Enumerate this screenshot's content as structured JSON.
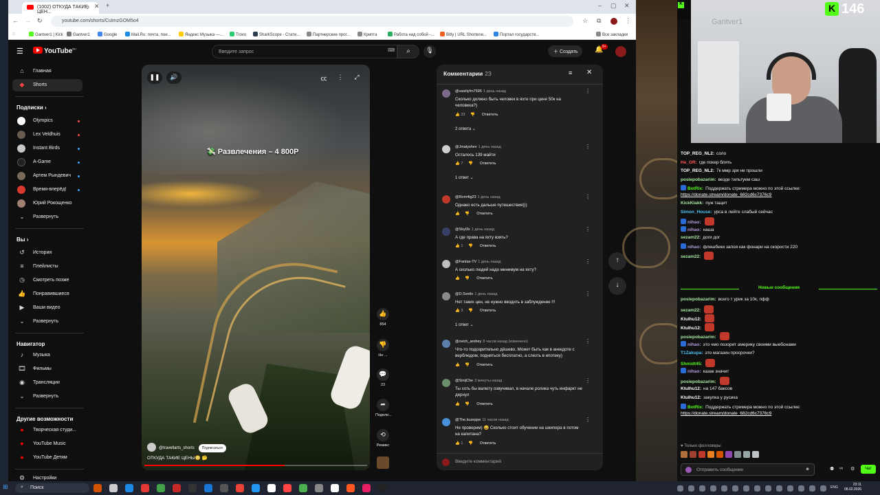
{
  "browser": {
    "tab_title": "(1002) ОТКУДА ТАКИЕ ЦЕН...",
    "url": "youtube.com/shorts/CuImzGOM5o4",
    "bookmarks": [
      "Gantver1 | Kick",
      "Gantver1",
      "Google",
      "Mail.Ru: почта, пои...",
      "Яндекс Музыка —...",
      "Trovo",
      "SharkScope - Стати...",
      "Партнерские прог...",
      "Крипта",
      "Работа над собой -...",
      "Bitly | URL Shortene...",
      "Портал государств..."
    ],
    "all_bookmarks": "Все закладки"
  },
  "header": {
    "logo_text": "YouTube",
    "logo_sup": "RU",
    "search_placeholder": "Введите запрос",
    "create_label": "Создать",
    "bell_badge": "9+"
  },
  "sidebar": {
    "main": [
      {
        "label": "Главная",
        "icon": "home-icon"
      },
      {
        "label": "Shorts",
        "icon": "shorts-icon"
      }
    ],
    "subs_header": "Подписки",
    "subscriptions": [
      {
        "label": "Olympics",
        "color": "#ffffff",
        "live": true
      },
      {
        "label": "Lex Veldhuis",
        "color": "#6a5b4f",
        "live": true
      },
      {
        "label": "Instant Birds",
        "color": "#c8c8c8",
        "live": false
      },
      {
        "label": "A-Game",
        "color": "#202020",
        "live": false
      },
      {
        "label": "Артем Рындевич",
        "color": "#7a6a5a",
        "live": false
      },
      {
        "label": "Время-вперёд!",
        "color": "#d9392c",
        "live": false
      },
      {
        "label": "Юрий Рокощенко",
        "color": "#a08070",
        "live": false
      }
    ],
    "expand1": "Развернуть",
    "you_header": "Вы",
    "you_items": [
      "История",
      "Плейлисты",
      "Смотреть позже",
      "Понравившиеся",
      "Ваши видео",
      "Развернуть"
    ],
    "nav_header": "Навигатор",
    "nav_items": [
      "Музыка",
      "Фильмы",
      "Трансляции",
      "Развернуть"
    ],
    "other_header": "Другие возможности",
    "other_items": [
      "Творческая студи...",
      "YouTube Music",
      "YouTube Детям"
    ],
    "settings": "Настройки"
  },
  "video": {
    "overlay_title": "Развлечения – 4 800Р",
    "channel": "@travellarts_shorts",
    "subscribe": "Подписаться",
    "caption": "ОТКУДА ТАКИЕ ЦЕНЫ😳 🤔",
    "progress": 0.63
  },
  "actions": {
    "likes": "854",
    "dislike": "Не ...",
    "comments": "23",
    "share": "Подели...",
    "remix": "Ремикс"
  },
  "comments": {
    "title": "Комментарии",
    "count": "23",
    "input_placeholder": "Введите комментарий",
    "items": [
      {
        "user": "@vasiliyfm7595",
        "time": "1 день назад",
        "text": "Сколько должно быть человек в яхте при цене 50к на человека?)",
        "likes": "33",
        "reply": "Ответить",
        "replies": "2 ответа",
        "color": "#7b6a8a"
      },
      {
        "user": "@Jmalyshev",
        "time": "1 день назад",
        "text": "Осталось 139 майти",
        "likes": "7",
        "reply": "Ответить",
        "replies": "1 ответ",
        "color": "#cfcfcf"
      },
      {
        "user": "@Rom4ig23",
        "time": "1 день назад",
        "text": "Однако есть дальше путешествия)))",
        "likes": "",
        "reply": "Ответить",
        "replies": "",
        "color": "#c0392b"
      },
      {
        "user": "@Skyl3x",
        "time": "1 день назад",
        "text": "А где права на яхту взять?",
        "likes": "1",
        "reply": "Ответить",
        "replies": "",
        "color": "#3a3f66"
      },
      {
        "user": "@Fantas-TV",
        "time": "1 день назад",
        "text": "А сколько людей надо минимум на яхту?",
        "likes": "",
        "reply": "Ответить",
        "replies": "",
        "color": "#bfbfbf"
      },
      {
        "user": "@D.Svetlo",
        "time": "1 день назад",
        "text": "Нет таких цен, не нужно вводить в заблуждение !!!",
        "likes": "3",
        "reply": "Ответить",
        "replies": "1 ответ",
        "color": "#8a8a8a"
      },
      {
        "user": "@ovich_andrey",
        "time": "8 часов назад (изменено)",
        "text": "Что-то подозрительно дёшево. Может быть как в анекдоте с верблюдом, подняться бесплатно, а слезть в ипотеку)",
        "likes": "",
        "reply": "Ответить",
        "replies": "",
        "color": "#5b7fa8"
      },
      {
        "user": "@SinijChe",
        "time": "3 минуты назад",
        "text": "Ты хоть бы валюту озвучивал, в начале ролика чуть инфаркт не дернул",
        "likes": "",
        "reply": "Ответить",
        "replies": "",
        "color": "#6b8f6b"
      },
      {
        "user": "@The.kuzeppe",
        "time": "11 часов назад",
        "text": "Не проверим) 😄 Сколько стоит обучение на шкипера в потом на капитана?",
        "likes": "1",
        "reply": "Ответить",
        "replies": "",
        "color": "#4a90d9"
      }
    ]
  },
  "stream": {
    "viewers": "146",
    "watermark": "Gantver1",
    "chat": [
      {
        "user": "TOP_REG_NL2",
        "msg": "соло",
        "color": "#ffffff"
      },
      {
        "user": "He_OR",
        "msg": "где покер блять",
        "color": "#ff5a5a"
      },
      {
        "user": "TOP_REG_NL2",
        "msg": "7к ммр зря не прошли",
        "color": "#ffffff"
      },
      {
        "user": "posiepobazarim",
        "msg": "везде тильтуем саш",
        "color": "#a8e6a1"
      },
      {
        "user": "BotRix",
        "msg": "Поддержать стримера можно по этой ссылке:",
        "color": "#53fc18",
        "link": "https://donate.stream/donate_682cd6c7376c9"
      },
      {
        "user": "KickKlakk",
        "msg": "пуж тащит",
        "color": "#a8e6a1"
      },
      {
        "user": "Simon_House",
        "msg": "урса в лейте слабый сейчас",
        "color": "#4fc3f7"
      },
      {
        "user": "nihao",
        "msg": "",
        "color": "#b39ddb"
      },
      {
        "user": "nihao",
        "msg": "наша",
        "color": "#b39ddb"
      },
      {
        "user": "sezam22",
        "msg": "доги дог",
        "color": "#a8e6a1"
      },
      {
        "user": "nihao",
        "msg": "флешбеки запоя как фонари на скорости 220",
        "color": "#b39ddb"
      },
      {
        "user": "sezam22",
        "msg": "",
        "color": "#a8e6a1"
      }
    ],
    "new_messages": "Новые сообщения",
    "chat2": [
      {
        "user": "posiepobazarim",
        "msg": "всего т урик за 10к, пфф",
        "color": "#a8e6a1"
      },
      {
        "user": "sezam22",
        "msg": "",
        "color": "#a8e6a1"
      },
      {
        "user": "Ktulhu12",
        "msg": "",
        "color": "#ffffff"
      },
      {
        "user": "Ktulhu12",
        "msg": "",
        "color": "#ffffff"
      },
      {
        "user": "posiepobazarim",
        "msg": "",
        "color": "#a8e6a1"
      },
      {
        "user": "nihao",
        "msg": "это чмо позорит америку своими выебонами",
        "color": "#b39ddb"
      },
      {
        "user": "T1Zakupa",
        "msg": "это магазин просрочки?",
        "color": "#4fc3f7"
      },
      {
        "user": "Shmidt45",
        "msg": "",
        "color": "#53fc18"
      },
      {
        "user": "nihao",
        "msg": "казак значит",
        "color": "#b39ddb"
      },
      {
        "user": "posiepobazarim",
        "msg": "",
        "color": "#a8e6a1"
      },
      {
        "user": "Ktulhu12",
        "msg": "на 147 баксов",
        "color": "#ffffff"
      },
      {
        "user": "Ktulhu12",
        "msg": "закупка у русика",
        "color": "#ffffff"
      },
      {
        "user": "BotRix",
        "msg": "Поддержать стримера можно по этой ссылке:",
        "color": "#53fc18",
        "link": "https://donate.stream/donate_682cd6c7376c9"
      }
    ],
    "followers_only": "Только фолловеры",
    "input_placeholder": "Отправить сообщение",
    "send": "Чат"
  },
  "taskbar": {
    "search": "Поиск",
    "lang": "ENG",
    "time": "23:11",
    "date": "08.02.2026"
  }
}
